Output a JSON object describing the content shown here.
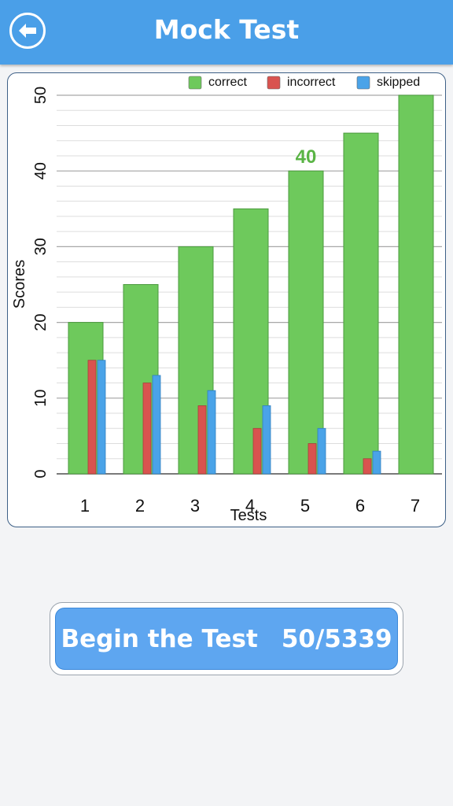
{
  "header": {
    "title": "Mock Test",
    "back_icon": "back-arrow-icon",
    "background": "#4a9fe8"
  },
  "chart_data": {
    "type": "bar",
    "xlabel": "Tests",
    "ylabel": "Scores",
    "ylim": [
      0,
      50
    ],
    "yticks": [
      0,
      10,
      20,
      30,
      40,
      50
    ],
    "grid": true,
    "legend_position": "top-right",
    "categories": [
      "1",
      "2",
      "3",
      "4",
      "5",
      "6",
      "7"
    ],
    "series": [
      {
        "name": "correct",
        "color": "#6ec95c",
        "values": [
          20,
          25,
          30,
          35,
          40,
          45,
          50
        ]
      },
      {
        "name": "incorrect",
        "color": "#d9534f",
        "values": [
          15,
          12,
          9,
          6,
          4,
          2,
          0
        ]
      },
      {
        "name": "skipped",
        "color": "#4aa3e8",
        "values": [
          15,
          13,
          11,
          9,
          6,
          3,
          0
        ]
      }
    ],
    "annotation": {
      "category": "5",
      "text": "40",
      "color": "#5ab445"
    }
  },
  "action": {
    "begin_label": "Begin the Test",
    "progress": "50/5339"
  }
}
